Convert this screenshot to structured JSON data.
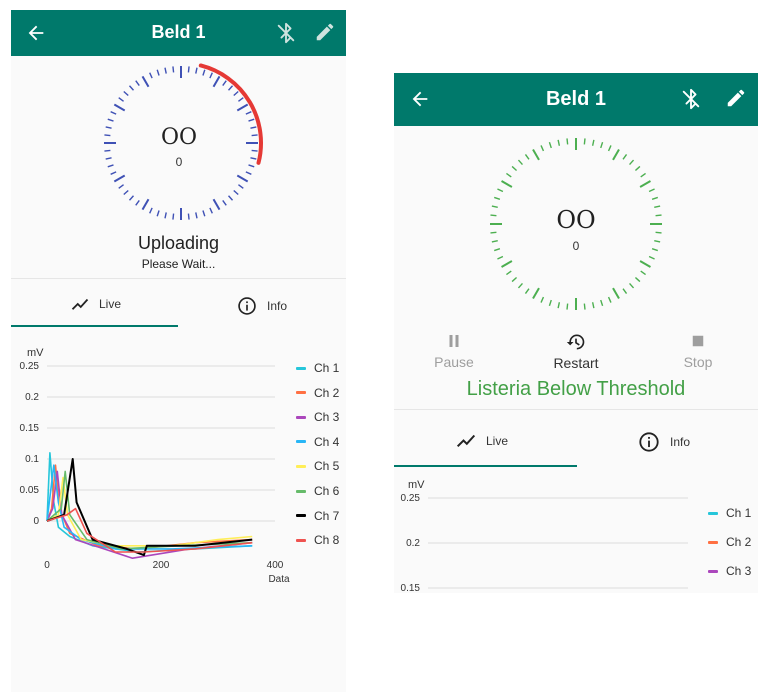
{
  "screen_a": {
    "title": "Beld 1",
    "dial_value": "OO",
    "dial_sub": "0",
    "status_title": "Uploading",
    "status_sub": "Please Wait...",
    "upload_progress": 0.25,
    "tabs": [
      {
        "label": "Live",
        "icon": "chart-line-icon"
      },
      {
        "label": "Info",
        "icon": "info-icon"
      }
    ],
    "legend": [
      {
        "name": "Ch 1",
        "color": "#26c6da"
      },
      {
        "name": "Ch 2",
        "color": "#ff7043"
      },
      {
        "name": "Ch 3",
        "color": "#ab47bc"
      },
      {
        "name": "Ch 4",
        "color": "#29b6f6"
      },
      {
        "name": "Ch 5",
        "color": "#ffee58"
      },
      {
        "name": "Ch 6",
        "color": "#66bb6a"
      },
      {
        "name": "Ch 7",
        "color": "#000000"
      },
      {
        "name": "Ch 8",
        "color": "#ef5350"
      }
    ],
    "chart_data": {
      "type": "line",
      "ylabel": "mV",
      "xlabel": "Data",
      "xlim": [
        0,
        400
      ],
      "ylim": [
        -0.05,
        0.25
      ],
      "x_ticks": [
        "0",
        "200",
        "400"
      ],
      "y_ticks": [
        "0.25",
        "0.2",
        "0.15",
        "0.1",
        "0.05",
        "0"
      ],
      "grid": true,
      "legend": "right",
      "series": [
        {
          "name": "Ch 1",
          "points": [
            [
              0,
              0
            ],
            [
              5,
              0.11
            ],
            [
              12,
              0.03
            ],
            [
              20,
              -0.01
            ],
            [
              40,
              -0.025
            ],
            [
              80,
              -0.04
            ],
            [
              160,
              -0.05
            ],
            [
              260,
              -0.045
            ],
            [
              360,
              -0.04
            ]
          ]
        },
        {
          "name": "Ch 2",
          "points": [
            [
              0,
              0
            ],
            [
              8,
              0.02
            ],
            [
              15,
              0.09
            ],
            [
              22,
              0.02
            ],
            [
              40,
              -0.02
            ],
            [
              90,
              -0.04
            ],
            [
              160,
              -0.045
            ],
            [
              260,
              -0.035
            ],
            [
              360,
              -0.03
            ]
          ]
        },
        {
          "name": "Ch 3",
          "points": [
            [
              0,
              0
            ],
            [
              10,
              0.02
            ],
            [
              18,
              0.08
            ],
            [
              26,
              0.01
            ],
            [
              50,
              -0.03
            ],
            [
              100,
              -0.045
            ],
            [
              150,
              -0.06
            ],
            [
              250,
              -0.045
            ],
            [
              360,
              -0.035
            ]
          ]
        },
        {
          "name": "Ch 4",
          "points": [
            [
              0,
              0
            ],
            [
              12,
              0.09
            ],
            [
              20,
              0.03
            ],
            [
              30,
              -0.01
            ],
            [
              60,
              -0.03
            ],
            [
              120,
              -0.045
            ],
            [
              220,
              -0.045
            ],
            [
              360,
              -0.04
            ]
          ]
        },
        {
          "name": "Ch 5",
          "points": [
            [
              0,
              0
            ],
            [
              20,
              0.01
            ],
            [
              28,
              0.07
            ],
            [
              36,
              0.01
            ],
            [
              60,
              -0.03
            ],
            [
              120,
              -0.04
            ],
            [
              220,
              -0.04
            ],
            [
              300,
              -0.03
            ],
            [
              360,
              -0.025
            ]
          ]
        },
        {
          "name": "Ch 6",
          "points": [
            [
              0,
              0
            ],
            [
              25,
              0.02
            ],
            [
              32,
              0.08
            ],
            [
              40,
              0.01
            ],
            [
              70,
              -0.03
            ],
            [
              130,
              -0.045
            ],
            [
              230,
              -0.04
            ],
            [
              360,
              -0.035
            ]
          ]
        },
        {
          "name": "Ch 7",
          "points": [
            [
              0,
              0
            ],
            [
              30,
              0.01
            ],
            [
              45,
              0.1
            ],
            [
              52,
              0.03
            ],
            [
              80,
              -0.03
            ],
            [
              140,
              -0.045
            ],
            [
              170,
              -0.055
            ],
            [
              175,
              -0.04
            ],
            [
              260,
              -0.04
            ],
            [
              360,
              -0.03
            ]
          ]
        },
        {
          "name": "Ch 8",
          "points": [
            [
              0,
              0
            ],
            [
              35,
              0.01
            ],
            [
              50,
              0.02
            ],
            [
              70,
              -0.02
            ],
            [
              120,
              -0.05
            ],
            [
              170,
              -0.05
            ],
            [
              260,
              -0.045
            ],
            [
              360,
              -0.035
            ]
          ]
        }
      ]
    }
  },
  "screen_b": {
    "title": "Beld 1",
    "dial_value": "OO",
    "dial_sub": "0",
    "controls": [
      {
        "label": "Pause",
        "icon": "pause-icon",
        "enabled": false
      },
      {
        "label": "Restart",
        "icon": "restart-icon",
        "enabled": true
      },
      {
        "label": "Stop",
        "icon": "stop-icon",
        "enabled": false
      }
    ],
    "status": "Listeria Below Threshold",
    "tabs": [
      {
        "label": "Live",
        "icon": "chart-line-icon"
      },
      {
        "label": "Info",
        "icon": "info-icon"
      }
    ],
    "legend": [
      {
        "name": "Ch 1",
        "color": "#26c6da"
      },
      {
        "name": "Ch 2",
        "color": "#ff7043"
      },
      {
        "name": "Ch 3",
        "color": "#ab47bc"
      }
    ],
    "chart_data": {
      "type": "line",
      "ylabel": "mV",
      "ylim": [
        0.15,
        0.25
      ],
      "y_ticks": [
        "0.25",
        "0.2",
        "0.15"
      ],
      "grid": true,
      "legend": "right",
      "series": []
    }
  },
  "colors": {
    "primary": "#00796b",
    "dial_a_ticks": "#3f51b5",
    "dial_a_arc": "#e53935",
    "dial_b_ticks": "#4caf50",
    "status_green": "#43a047",
    "disabled": "#9e9e9e"
  }
}
